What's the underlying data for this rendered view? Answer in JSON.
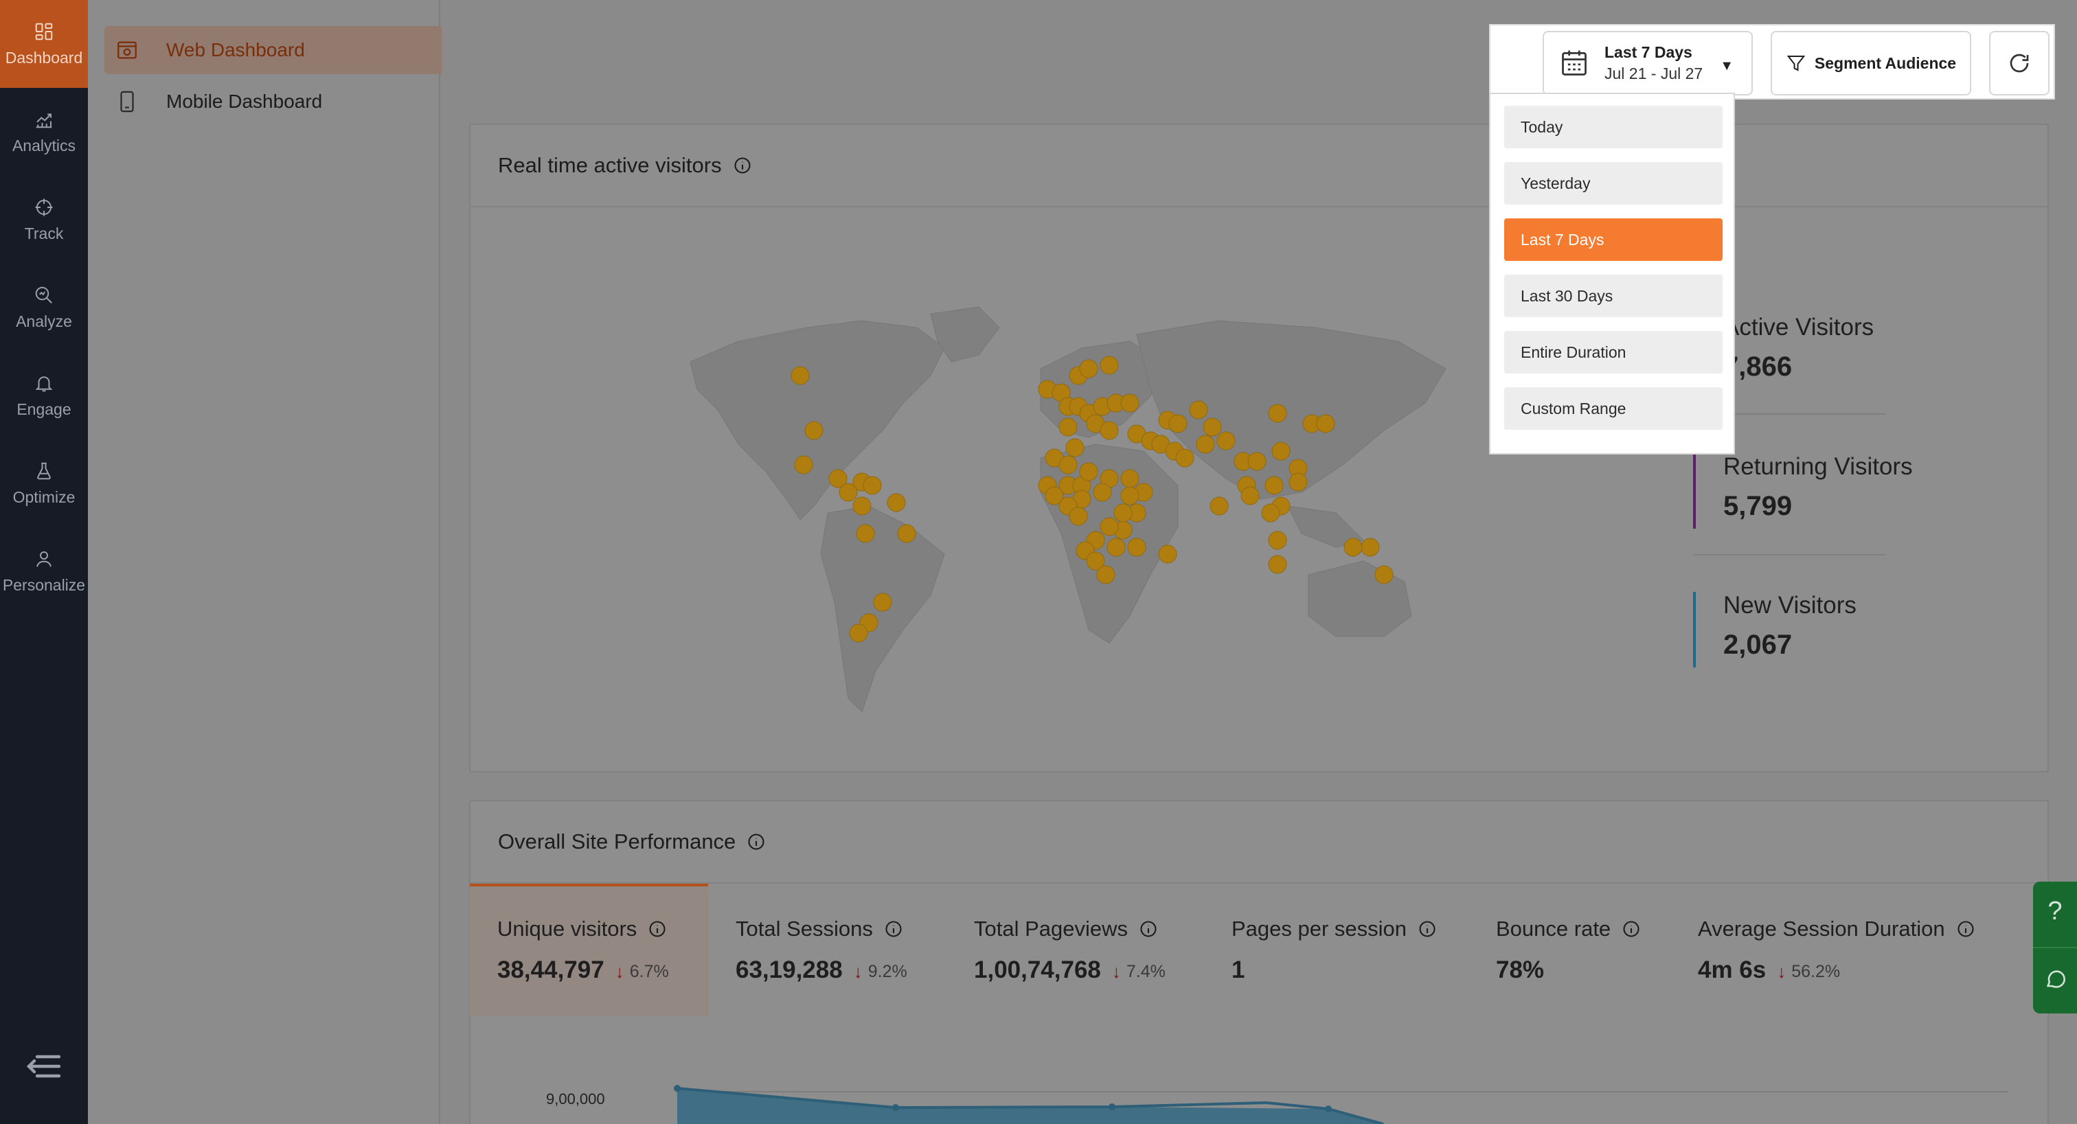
{
  "sidebar": {
    "items": [
      {
        "label": "Dashboard",
        "icon": "dashboard-icon"
      },
      {
        "label": "Analytics",
        "icon": "analytics-icon"
      },
      {
        "label": "Track",
        "icon": "crosshair-icon"
      },
      {
        "label": "Analyze",
        "icon": "magnify-icon"
      },
      {
        "label": "Engage",
        "icon": "bell-icon"
      },
      {
        "label": "Optimize",
        "icon": "flask-icon"
      },
      {
        "label": "Personalize",
        "icon": "user-icon"
      }
    ]
  },
  "subnav": {
    "web": "Web Dashboard",
    "mobile": "Mobile Dashboard"
  },
  "realtime": {
    "title": "Real time active visitors",
    "active_label": "Active Visitors",
    "active_value": "7,866",
    "returning_label": "Returning Visitors",
    "returning_value": "5,799",
    "new_label": "New Visitors",
    "new_value": "2,067"
  },
  "toolbar": {
    "date_title": "Last 7 Days",
    "date_range": "Jul 21 - Jul 27",
    "segment_label": "Segment Audience"
  },
  "dropdown": {
    "options": [
      "Today",
      "Yesterday",
      "Last 7 Days",
      "Last 30 Days",
      "Entire Duration",
      "Custom Range"
    ],
    "selected": "Last 7 Days"
  },
  "performance": {
    "title": "Overall Site Performance",
    "metrics": [
      {
        "label": "Unique visitors",
        "value": "38,44,797",
        "change": "6.7%"
      },
      {
        "label": "Total Sessions",
        "value": "63,19,288",
        "change": "9.2%"
      },
      {
        "label": "Total Pageviews",
        "value": "1,00,74,768",
        "change": "7.4%"
      },
      {
        "label": "Pages per session",
        "value": "1",
        "change": ""
      },
      {
        "label": "Bounce rate",
        "value": "78%",
        "change": ""
      },
      {
        "label": "Average Session Duration",
        "value": "4m 6s",
        "change": "56.2%"
      }
    ],
    "y_tick": "9,00,000"
  },
  "colors": {
    "accent": "#f47b30",
    "brand": "#b9521d",
    "rail": "#161b26",
    "map_marker": "#b07d0f",
    "returning_bar": "#5e1f66",
    "new_bar": "#1f6a8f",
    "help": "#17692d"
  }
}
